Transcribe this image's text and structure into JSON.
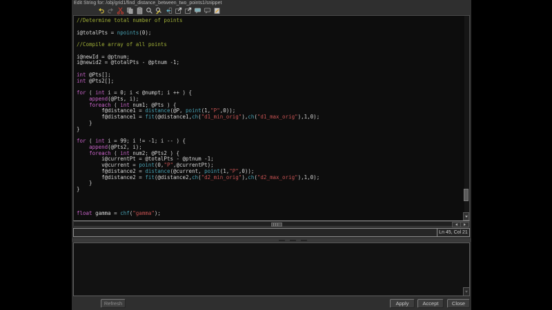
{
  "window": {
    "title": "Edit String for: /obj/grid1/find_distance_between_two_points1/snippet"
  },
  "toolbar": {
    "icons": [
      {
        "name": "undo",
        "color": "#d9c33c"
      },
      {
        "name": "redo",
        "color": "#6a6a6a"
      },
      {
        "name": "cut",
        "color": "#b43a2e"
      },
      {
        "name": "copy",
        "color": "#b0b0b0"
      },
      {
        "name": "paste",
        "color": "#b0b0b0"
      },
      {
        "name": "find",
        "color": "#c0c0c0"
      },
      {
        "name": "find-replace",
        "color": "#c0c0c0"
      },
      {
        "name": "goto-line",
        "color": "#5fb3c9"
      },
      {
        "name": "expand-window",
        "color": "#9a9a9a"
      },
      {
        "name": "shrink-window",
        "color": "#9a9a9a"
      },
      {
        "name": "comment",
        "color": "#7fb0b8"
      },
      {
        "name": "uncomment",
        "color": "#9a9a9a"
      },
      {
        "name": "external-editor",
        "color": "#c9c9c9"
      }
    ]
  },
  "editor": {
    "colors": {
      "background": "#0d0d0d",
      "plain": "#d6d6d6",
      "comment": "#9fae37",
      "keyword": "#c964c9",
      "function": "#47a1b3",
      "string": "#c75252"
    },
    "code_lines": [
      [
        [
          "c",
          "//Determine total number of points"
        ]
      ],
      [],
      [
        [
          "p",
          "i@totalPts = "
        ],
        [
          "f",
          "npoints"
        ],
        [
          "p",
          "(0);"
        ]
      ],
      [],
      [
        [
          "c",
          "//Compile array of all points"
        ]
      ],
      [],
      [
        [
          "p",
          "i@newId = @ptnum;"
        ]
      ],
      [
        [
          "p",
          "i@newid2 = @totalPts - @ptnum -1;"
        ]
      ],
      [],
      [
        [
          "k",
          "int"
        ],
        [
          "p",
          " @Pts[];"
        ]
      ],
      [
        [
          "k",
          "int"
        ],
        [
          "p",
          " @Pts2[];"
        ]
      ],
      [],
      [
        [
          "k",
          "for"
        ],
        [
          "p",
          " ( "
        ],
        [
          "k",
          "int"
        ],
        [
          "p",
          " i = 0; i < @numpt; i ++ ) {"
        ]
      ],
      [
        [
          "p",
          "    "
        ],
        [
          "k",
          "append"
        ],
        [
          "p",
          "(@Pts, i);"
        ]
      ],
      [
        [
          "p",
          "    "
        ],
        [
          "k",
          "foreach"
        ],
        [
          "p",
          " ( "
        ],
        [
          "k",
          "int"
        ],
        [
          "p",
          " num1; @Pts ) {"
        ]
      ],
      [
        [
          "p",
          "        f@distance1 = "
        ],
        [
          "f",
          "distance"
        ],
        [
          "p",
          "(@P, "
        ],
        [
          "f",
          "point"
        ],
        [
          "p",
          "(1,"
        ],
        [
          "s",
          "\"P\""
        ],
        [
          "p",
          ",0));"
        ]
      ],
      [
        [
          "p",
          "        f@distance1 = "
        ],
        [
          "f",
          "fit"
        ],
        [
          "p",
          "(@distance1,"
        ],
        [
          "f",
          "ch"
        ],
        [
          "p",
          "("
        ],
        [
          "s",
          "\"d1_min_orig\""
        ],
        [
          "p",
          "),"
        ],
        [
          "f",
          "ch"
        ],
        [
          "p",
          "("
        ],
        [
          "s",
          "\"d1_max_orig\""
        ],
        [
          "p",
          "),1,0);"
        ]
      ],
      [
        [
          "p",
          "    }"
        ]
      ],
      [
        [
          "p",
          "}"
        ]
      ],
      [],
      [
        [
          "k",
          "for"
        ],
        [
          "p",
          " ( "
        ],
        [
          "k",
          "int"
        ],
        [
          "p",
          " i = 99; i != -1; i -- ) {"
        ]
      ],
      [
        [
          "p",
          "    "
        ],
        [
          "k",
          "append"
        ],
        [
          "p",
          "(@Pts2, i);"
        ]
      ],
      [
        [
          "p",
          "    "
        ],
        [
          "k",
          "foreach"
        ],
        [
          "p",
          " ( "
        ],
        [
          "k",
          "int"
        ],
        [
          "p",
          " num2; @Pts2 ) {"
        ]
      ],
      [
        [
          "p",
          "        i@currentPt = @totalPts - @ptnum -1;"
        ]
      ],
      [
        [
          "p",
          "        v@current = "
        ],
        [
          "f",
          "point"
        ],
        [
          "p",
          "(0,"
        ],
        [
          "s",
          "\"P\""
        ],
        [
          "p",
          ",@currentPt);"
        ]
      ],
      [
        [
          "p",
          "        f@distance2 = "
        ],
        [
          "f",
          "distance"
        ],
        [
          "p",
          "(@current, "
        ],
        [
          "f",
          "point"
        ],
        [
          "p",
          "(1,"
        ],
        [
          "s",
          "\"P\""
        ],
        [
          "p",
          ",0));"
        ]
      ],
      [
        [
          "p",
          "        f@distance2 = "
        ],
        [
          "f",
          "fit"
        ],
        [
          "p",
          "(@distance2,"
        ],
        [
          "f",
          "ch"
        ],
        [
          "p",
          "("
        ],
        [
          "s",
          "\"d2_min_orig\""
        ],
        [
          "p",
          "),"
        ],
        [
          "f",
          "ch"
        ],
        [
          "p",
          "("
        ],
        [
          "s",
          "\"d2_max_orig\""
        ],
        [
          "p",
          "),1,0);"
        ]
      ],
      [
        [
          "p",
          "    }"
        ]
      ],
      [
        [
          "p",
          "}"
        ]
      ],
      [],
      [],
      [],
      [
        [
          "k",
          "float"
        ],
        [
          "p",
          " gamma = "
        ],
        [
          "f",
          "chf"
        ],
        [
          "p",
          "("
        ],
        [
          "s",
          "\"gamma\""
        ],
        [
          "p",
          ");"
        ]
      ]
    ]
  },
  "status": {
    "cursor_position": "Ln 45, Col 21"
  },
  "footer": {
    "refresh_label": "Refresh",
    "apply_label": "Apply",
    "accept_label": "Accept",
    "close_label": "Close"
  }
}
